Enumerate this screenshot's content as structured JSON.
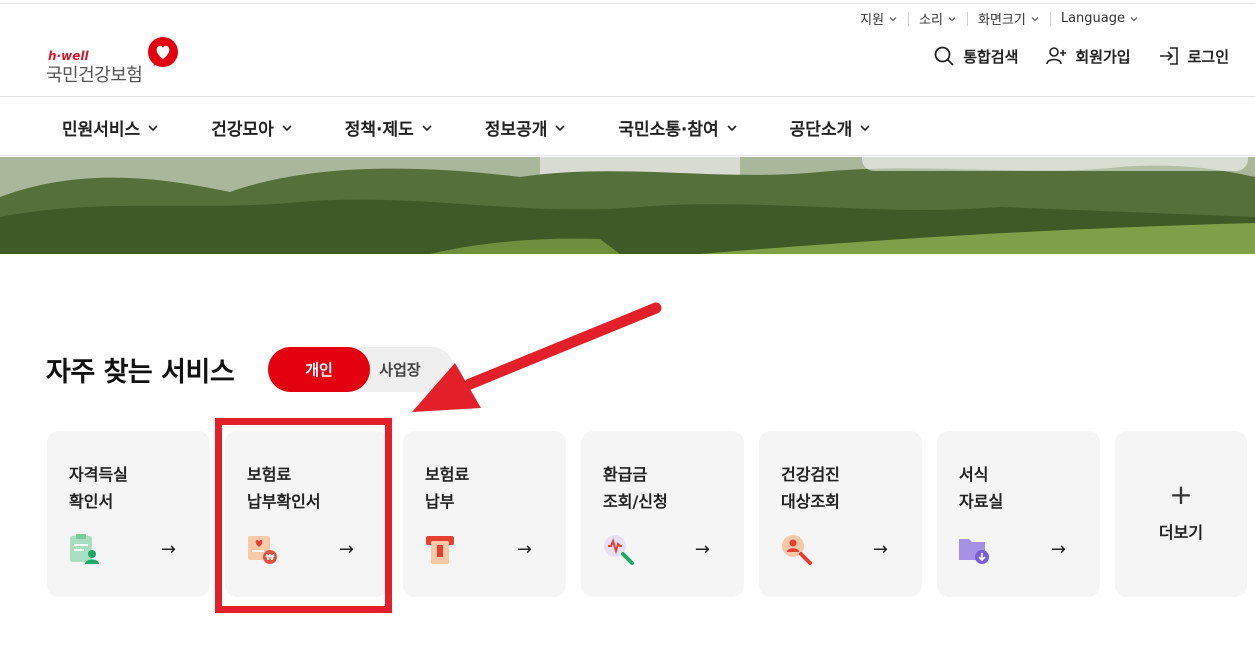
{
  "utility": {
    "items": [
      {
        "label": "지원"
      },
      {
        "label": "소리"
      },
      {
        "label": "화면크기"
      },
      {
        "label": "Language"
      }
    ]
  },
  "logo": {
    "tagline": "h·well",
    "name": "국민건강보험",
    "brand_color": "#d6182c"
  },
  "header_actions": {
    "search": "통합검색",
    "signup": "회원가입",
    "login": "로그인"
  },
  "gnb": {
    "items": [
      {
        "label": "민원서비스"
      },
      {
        "label": "건강모아"
      },
      {
        "label": "정책·제도"
      },
      {
        "label": "정보공개"
      },
      {
        "label": "국민소통·참여"
      },
      {
        "label": "공단소개"
      }
    ]
  },
  "services": {
    "title": "자주 찾는 서비스",
    "toggle": {
      "active": "개인",
      "inactive": "사업장"
    },
    "cards": [
      {
        "title": "자격득실\n확인서",
        "icon": "certificate-person-icon"
      },
      {
        "title": "보험료\n납부확인서",
        "icon": "payment-receipt-icon"
      },
      {
        "title": "보험료\n납부",
        "icon": "atm-card-icon"
      },
      {
        "title": "환급금\n조회/신청",
        "icon": "refund-search-icon"
      },
      {
        "title": "건강검진\n대상조회",
        "icon": "checkup-search-icon"
      },
      {
        "title": "서식\n자료실",
        "icon": "folder-download-icon"
      }
    ],
    "more": {
      "plus": "+",
      "label": "더보기"
    },
    "arrow_glyph": "→"
  },
  "colors": {
    "accent": "#e3000f",
    "annotation": "#e3202a",
    "card_bg": "#f5f5f5"
  }
}
